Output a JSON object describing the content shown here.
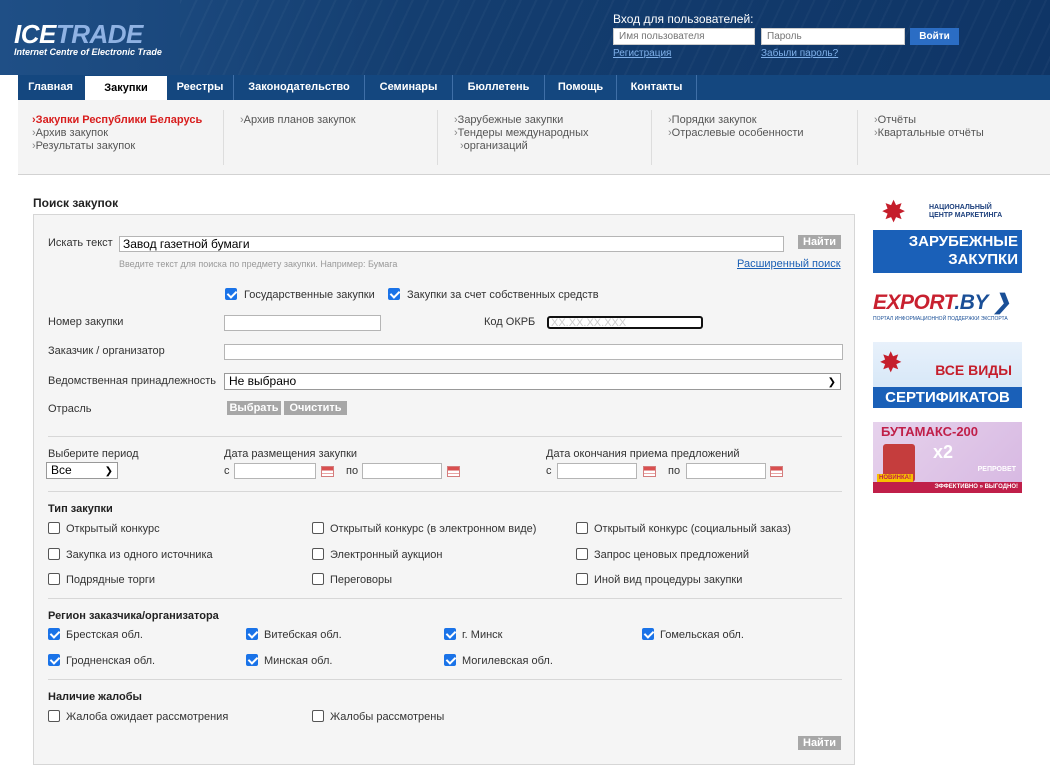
{
  "header": {
    "logo_main_ice": "ICE",
    "logo_main_trade": "TRADE",
    "logo_sub": "Internet Centre of Electronic Trade",
    "login_title": "Вход для пользователей:",
    "username_placeholder": "Имя пользователя",
    "password_placeholder": "Пароль",
    "login_button": "Войти",
    "register_link": "Регистрация",
    "forgot_link": "Забыли пароль?"
  },
  "nav": {
    "items": [
      "Главная",
      "Закупки",
      "Реестры",
      "Законодательство",
      "Семинары",
      "Бюллетень",
      "Помощь",
      "Контакты"
    ],
    "active": "Закупки"
  },
  "submenu": {
    "col1": [
      "Закупки Республики Беларусь",
      "Архив закупок",
      "Результаты закупок"
    ],
    "col2": [
      "Архив планов закупок"
    ],
    "col3": [
      "Зарубежные закупки",
      "Тендеры международных",
      "организаций"
    ],
    "col4": [
      "Порядки закупок",
      "Отраслевые особенности"
    ],
    "col5": [
      "Отчёты",
      "Квартальные отчёты"
    ]
  },
  "search": {
    "title": "Поиск закупок",
    "text_label": "Искать текст",
    "text_value": "Завод газетной бумаги",
    "find_button": "Найти",
    "hint": "Введите текст для поиска по предмету закупки. Например: Бумага",
    "advanced_link": "Расширенный поиск",
    "checkbox_state": "Государственные закупки",
    "checkbox_own": "Закупки за счет собственных средств",
    "number_label": "Номер закупки",
    "okrb_label": "Код ОКРБ",
    "okrb_placeholder": "XX.XX.XX.XXX",
    "customer_label": "Заказчик / организатор",
    "dept_label": "Ведомственная принадлежность",
    "dept_value": "Не выбрано",
    "industry_label": "Отрасль",
    "choose_button": "Выбрать",
    "clear_button": "Очистить",
    "period_label": "Выберите период",
    "period_value": "Все",
    "placed_label": "Дата размещения закупки",
    "deadline_label": "Дата окончания приема предложений",
    "from": "с",
    "to": "по",
    "type_title": "Тип закупки",
    "types": [
      "Открытый конкурс",
      "Открытый конкурс (в электронном виде)",
      "Открытый конкурс (социальный заказ)",
      "Закупка из одного источника",
      "Электронный аукцион",
      "Запрос ценовых предложений",
      "Подрядные торги",
      "Переговоры",
      "Иной вид процедуры закупки"
    ],
    "region_title": "Регион заказчика/организатора",
    "regions": [
      "Брестская обл.",
      "Витебская обл.",
      "г. Минск",
      "Гомельская обл.",
      "Гродненская обл.",
      "Минская обл.",
      "Могилевская обл."
    ],
    "complaint_title": "Наличие жалобы",
    "complaints": [
      "Жалоба ожидает рассмотрения",
      "Жалобы рассмотрены"
    ],
    "bottom_find": "Найти"
  },
  "ads": {
    "ad1_nat": "НАЦИОНАЛЬНЫЙ\nЦЕНТР МАРКЕТИНГА",
    "ad1_line1": "ЗАРУБЕЖНЫЕ",
    "ad1_line2": "ЗАКУПКИ",
    "ad2_export": "EXPORT",
    "ad2_by": ".BY",
    "ad2_sub": "ПОРТАЛ ИНФОРМАЦИОННОЙ ПОДДЕРЖКИ ЭКСПОРТА",
    "ad3_vse": "ВСЕ ВИДЫ",
    "ad3_sert": "СЕРТИФИКАТОВ",
    "ad4_but": "БУТАМАКС-200",
    "ad4_x2": "x2",
    "ad4_rep": "РЕПРОВЕТ",
    "ad4_eff": "ЭФФЕКТИВНО » ВЫГОДНО!",
    "ad4_nov": "НОВИНКА!"
  }
}
